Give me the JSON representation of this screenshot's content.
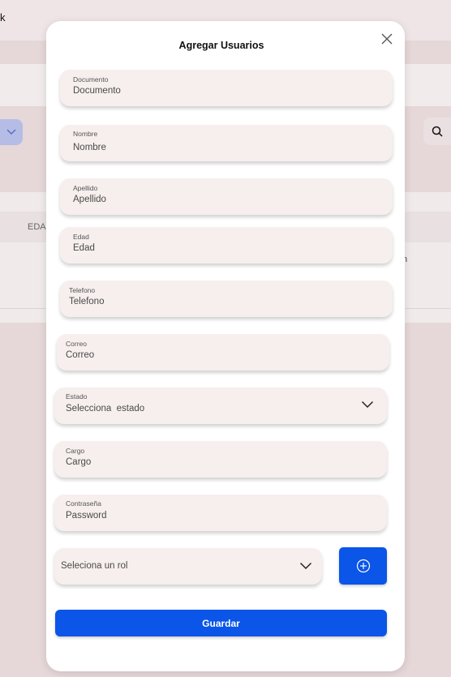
{
  "background": {
    "topbar_text": "k",
    "table_column_edad": "EDAD",
    "table_cell_partial": "n"
  },
  "modal": {
    "title": "Agregar Usuarios",
    "close_icon": "close-icon",
    "fields": {
      "documento": {
        "label": "Documento",
        "value": "Documento"
      },
      "nombre": {
        "label": "Nombre",
        "value": "Nombre"
      },
      "apellido": {
        "label": "Apellido",
        "value": "Apellido"
      },
      "edad": {
        "label": "Edad",
        "value": "Edad"
      },
      "telefono": {
        "label": "Telefono",
        "value": "Telefono"
      },
      "correo": {
        "label": "Correo",
        "value": "Correo"
      },
      "estado": {
        "label": "Estado",
        "value": "Selecciona  estado"
      },
      "cargo": {
        "label": "Cargo",
        "value": "Cargo"
      },
      "contrasena": {
        "label": "Contraseña",
        "value": "Password"
      }
    },
    "role_select": {
      "value": "Seleciona un rol"
    },
    "add_role_icon": "plus-circle-icon",
    "save_label": "Guardar"
  },
  "colors": {
    "primary": "#0b55e8",
    "field_bg": "#f6efee",
    "overlay_bg": "#e6d7d8"
  }
}
